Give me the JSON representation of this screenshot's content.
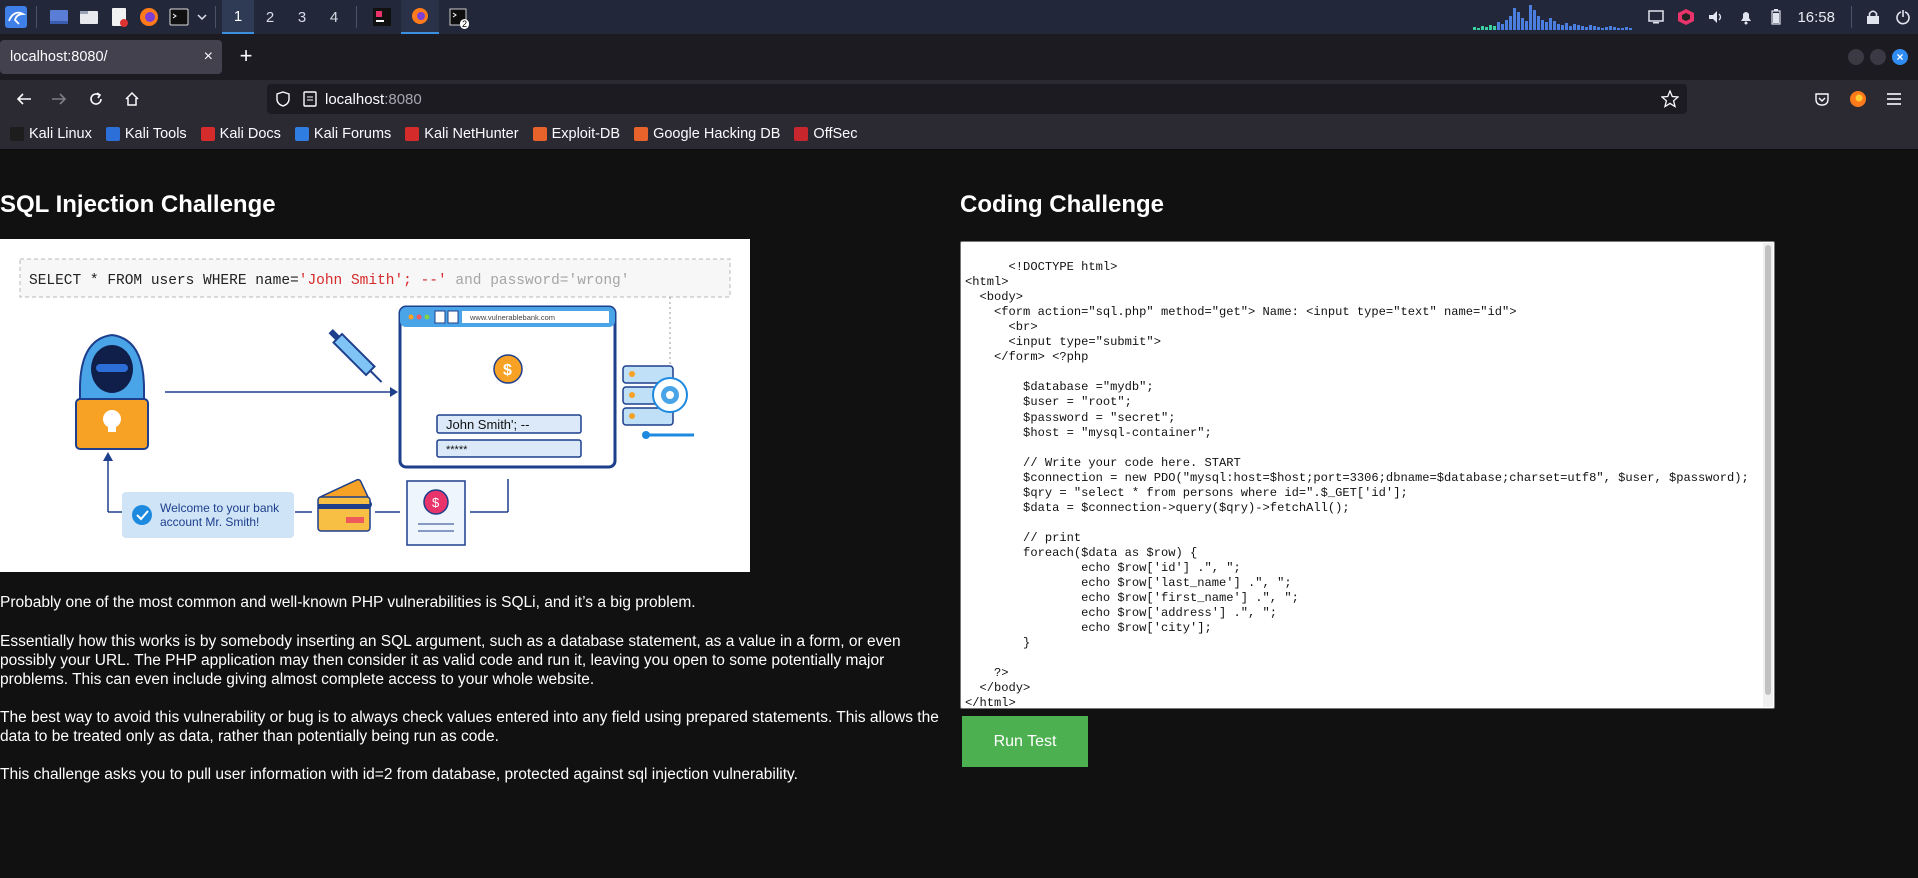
{
  "taskbar": {
    "workspaces": [
      "1",
      "2",
      "3",
      "4"
    ],
    "terminal_badge": "2",
    "clock": "16:58"
  },
  "browser": {
    "tab_title": "localhost:8080/",
    "tab_close": "×",
    "new_tab": "+",
    "url_host": "localhost",
    "url_port": ":8080",
    "bookmarks": [
      {
        "label": "Kali Linux",
        "color": "#1d1d1d"
      },
      {
        "label": "Kali Tools",
        "color": "#2d6fd8"
      },
      {
        "label": "Kali Docs",
        "color": "#d62b2b"
      },
      {
        "label": "Kali Forums",
        "color": "#2f7de1"
      },
      {
        "label": "Kali NetHunter",
        "color": "#d62b2b"
      },
      {
        "label": "Exploit-DB",
        "color": "#e8622c"
      },
      {
        "label": "Google Hacking DB",
        "color": "#e8622c"
      },
      {
        "label": "OffSec",
        "color": "#c7262c"
      }
    ]
  },
  "left": {
    "title": "SQL Injection Challenge",
    "illustration": {
      "query_prefix": "SELECT * FROM users WHERE name=",
      "query_injected": "'John Smith'; --'",
      "query_suffix": " and password='wrong'",
      "browser_url": "www.vulnerablebank.com",
      "input_value": "John Smith'; --",
      "password_mask": "*****",
      "welcome_line1": "Welcome to your bank",
      "welcome_line2": "account Mr. Smith!"
    },
    "paragraphs": [
      "Probably one of the most common and well-known PHP vulnerabilities is SQLi, and it’s a big problem.",
      "Essentially how this works is by somebody inserting an SQL argument, such as a database statement, as a value in a form, or even possibly your URL. The PHP application may then consider it as valid code and run it, leaving you open to some potentially major problems. This can even include giving almost complete access to your whole website.",
      "The best way to avoid this vulnerability or bug is to always check values entered into any field using prepared statements. This allows the data to be treated only as data, rather than potentially being run as code.",
      "This challenge asks you to pull user information with id=2 from database, protected against sql injection vulnerability."
    ]
  },
  "right": {
    "title": "Coding Challenge",
    "code": "<!DOCTYPE html>\n<html>\n  <body>\n    <form action=\"sql.php\" method=\"get\"> Name: <input type=\"text\" name=\"id\">\n      <br>\n      <input type=\"submit\">\n    </form> <?php\n\n        $database =\"mydb\";\n        $user = \"root\";\n        $password = \"secret\";\n        $host = \"mysql-container\";\n\n        // Write your code here. START\n        $connection = new PDO(\"mysql:host=$host;port=3306;dbname=$database;charset=utf8\", $user, $password);\n        $qry = \"select * from persons where id=\".$_GET['id'];\n        $data = $connection->query($qry)->fetchAll();\n\n        // print\n        foreach($data as $row) {\n                echo $row['id'] .\", \";\n                echo $row['last_name'] .\", \";\n                echo $row['first_name'] .\", \";\n                echo $row['address'] .\", \";\n                echo $row['city'];\n        }\n\n    ?>\n  </body>\n</html>",
    "run_button": "Run Test"
  }
}
